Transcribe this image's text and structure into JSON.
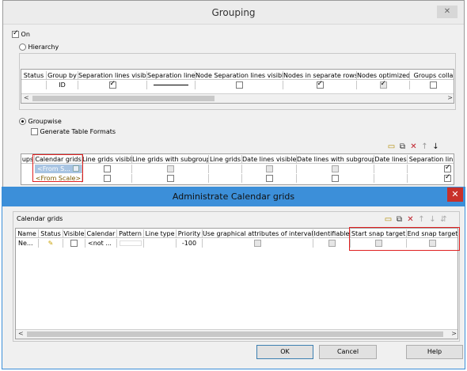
{
  "grouping": {
    "title": "Grouping",
    "close_glyph": "✕",
    "on_label": "On",
    "on_checked": true,
    "hierarchy_label": "Hierarchy",
    "hierarchy_selected": false,
    "hierarchy_table": {
      "headers": [
        "Status",
        "Group by",
        "Separation lines visible",
        "Separation line",
        "Node Separation lines visible",
        "Nodes in separate rows",
        "Nodes optimized",
        "Groups colla"
      ],
      "row": {
        "group_by": "ID",
        "separation_lines_visible": true,
        "node_separation_lines_visible": false,
        "nodes_in_separate_rows": true,
        "nodes_optimized": true,
        "groups_collapsed": false
      }
    },
    "groupwise_label": "Groupwise",
    "groupwise_selected": true,
    "generate_table_formats_label": "Generate Table Formats",
    "generate_table_formats_checked": false,
    "groupwise_table": {
      "headers": [
        "ups",
        "Calendar grids",
        "Line grids visible",
        "Line grids with subgroups",
        "Line grids",
        "Date lines visible",
        "Date lines with subgroups",
        "Date lines",
        "Separation lin"
      ],
      "rows": [
        {
          "calendar_grid": "<From S...",
          "selected": true,
          "separation_line": true
        },
        {
          "calendar_grid": "<From Scale>",
          "selected": false,
          "separation_line": true
        }
      ]
    },
    "toolbar_icons": [
      "add-row-icon",
      "copy-icon",
      "delete-icon",
      "move-up-icon",
      "move-down-icon"
    ]
  },
  "admin": {
    "title": "Administrate Calendar grids",
    "close_glyph": "✕",
    "group_label": "Calendar grids",
    "headers": [
      "Name",
      "Status",
      "Visible",
      "Calendar",
      "Pattern",
      "Line type",
      "Priority",
      "Use graphical attributes of intervals",
      "Identifiable",
      "Start snap target",
      "End snap target"
    ],
    "row": {
      "name": "Ne...",
      "status_icon": "pencil-icon",
      "visible": false,
      "calendar": "<not ...",
      "pattern": "",
      "line_type": "",
      "priority": "-100",
      "use_graphical_attributes": false,
      "identifiable": false,
      "start_snap_target": false,
      "end_snap_target": false
    },
    "toolbar_icons": [
      "add-row-icon",
      "copy-icon",
      "delete-icon",
      "move-up-icon",
      "move-down-icon",
      "split-icon"
    ],
    "buttons": {
      "ok": "OK",
      "cancel": "Cancel",
      "help": "Help"
    }
  },
  "colors": {
    "highlight": "#e02020",
    "title_accent": "#3c8fd9",
    "close_red": "#c8302a"
  }
}
